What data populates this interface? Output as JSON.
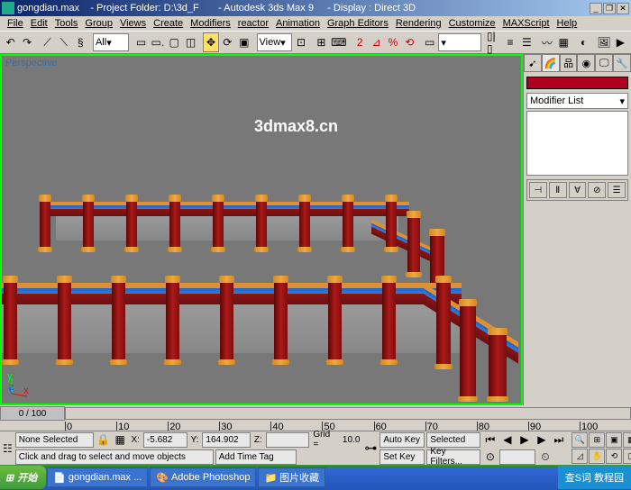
{
  "title": "gongdian.max    - Project Folder: D:\\3d_F       - Autodesk 3ds Max 9     - Display : Direct 3D",
  "menu": [
    "File",
    "Edit",
    "Tools",
    "Group",
    "Views",
    "Create",
    "Modifiers",
    "reactor",
    "Animation",
    "Graph Editors",
    "Rendering",
    "Customize",
    "MAXScript",
    "Help"
  ],
  "toolbar": {
    "selfilter": "All",
    "refcoord": "View"
  },
  "viewport": {
    "label": "Perspective",
    "watermark": "3dmax8.cn",
    "axes": {
      "x": "x",
      "y": "y",
      "z": "z"
    }
  },
  "cmdpanel": {
    "modifier_label": "Modifier List"
  },
  "timeline": {
    "slider": "0 / 100",
    "ticks": [
      "0",
      "10",
      "20",
      "30",
      "40",
      "50",
      "60",
      "70",
      "80",
      "90",
      "100"
    ]
  },
  "status": {
    "selection": "None Selected",
    "x_lbl": "X:",
    "x": "-5.682",
    "y_lbl": "Y:",
    "y": "164.902",
    "z_lbl": "Z:",
    "z": "",
    "grid_lbl": "Grid =",
    "grid": "10.0",
    "prompt": "Click and drag to select and move objects",
    "addtime": "Add Time Tag",
    "autokey": "Auto Key",
    "setkey": "Set Key",
    "keyfilters": "Key Filters...",
    "selected": "Selected"
  },
  "taskbar": {
    "start": "开始",
    "tasks": [
      "gongdian.max ...",
      "Adobe Photoshop",
      "图片收藏"
    ],
    "tray": "查S词 教程园"
  }
}
